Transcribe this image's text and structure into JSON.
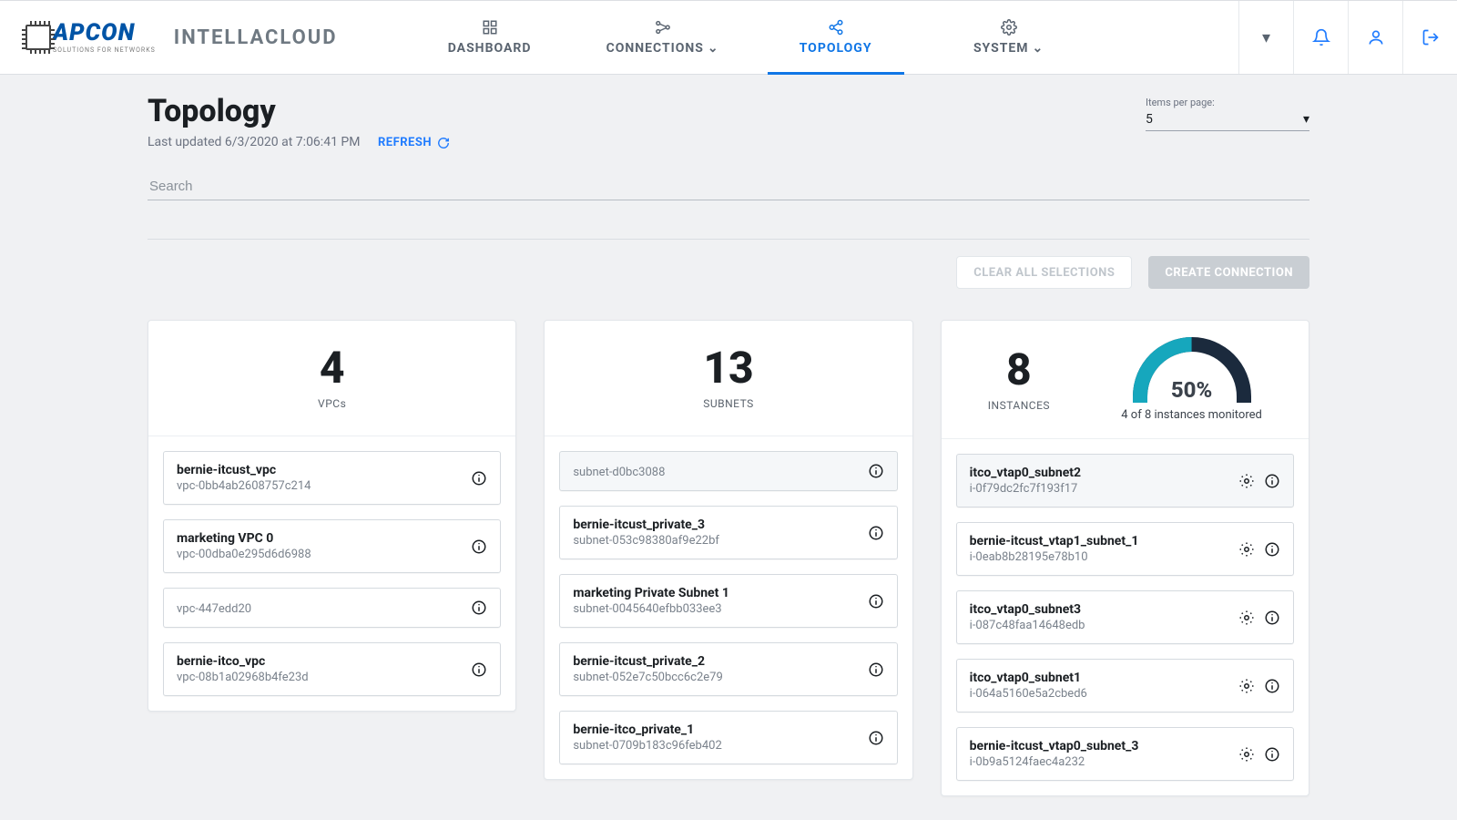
{
  "brand": {
    "name": "APCON",
    "tagline": "Solutions for Networks",
    "app": "INTELLACLOUD"
  },
  "nav": {
    "dashboard": "DASHBOARD",
    "connections": "CONNECTIONS",
    "topology": "TOPOLOGY",
    "system": "SYSTEM"
  },
  "page": {
    "title": "Topology",
    "updated_prefix": "Last updated ",
    "updated": "6/3/2020 at 7:06:41 PM",
    "refresh": "REFRESH",
    "items_per_page_label": "Items per page:",
    "items_per_page_value": "5",
    "search_placeholder": "Search",
    "clear_btn": "CLEAR ALL SELECTIONS",
    "create_btn": "CREATE CONNECTION"
  },
  "vpcs": {
    "count": "4",
    "label": "VPCs",
    "items": [
      {
        "name": "bernie-itcust_vpc",
        "id": "vpc-0bb4ab2608757c214"
      },
      {
        "name": "marketing VPC 0",
        "id": "vpc-00dba0e295d6d6988"
      },
      {
        "name": "",
        "id": "vpc-447edd20"
      },
      {
        "name": "bernie-itco_vpc",
        "id": "vpc-08b1a02968b4fe23d"
      }
    ]
  },
  "subnets": {
    "count": "13",
    "label": "SUBNETS",
    "items": [
      {
        "name": "",
        "id": "subnet-d0bc3088"
      },
      {
        "name": "bernie-itcust_private_3",
        "id": "subnet-053c98380af9e22bf"
      },
      {
        "name": "marketing Private Subnet 1",
        "id": "subnet-0045640efbb033ee3"
      },
      {
        "name": "bernie-itcust_private_2",
        "id": "subnet-052e7c50bcc6c2e79"
      },
      {
        "name": "bernie-itco_private_1",
        "id": "subnet-0709b183c96feb402"
      }
    ]
  },
  "instances": {
    "count": "8",
    "label": "INSTANCES",
    "gauge_pct": "50%",
    "gauge_caption": "4 of 8 instances monitored",
    "items": [
      {
        "name": "itco_vtap0_subnet2",
        "id": "i-0f79dc2fc7f193f17"
      },
      {
        "name": "bernie-itcust_vtap1_subnet_1",
        "id": "i-0eab8b28195e78b10"
      },
      {
        "name": "itco_vtap0_subnet3",
        "id": "i-087c48faa14648edb"
      },
      {
        "name": "itco_vtap0_subnet1",
        "id": "i-064a5160e5a2cbed6"
      },
      {
        "name": "bernie-itcust_vtap0_subnet_3",
        "id": "i-0b9a5124faec4a232"
      }
    ]
  }
}
